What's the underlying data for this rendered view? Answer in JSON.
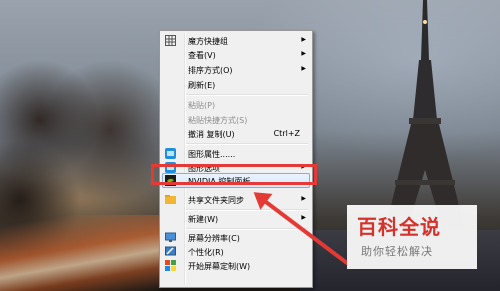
{
  "context_menu": {
    "items": [
      {
        "label": "魔方快捷组",
        "icon": "grid-icon",
        "submenu": true
      },
      {
        "label": "查看(V)",
        "submenu": true
      },
      {
        "label": "排序方式(O)",
        "submenu": true
      },
      {
        "label": "刷新(E)"
      },
      {
        "label": "粘贴(P)",
        "disabled": true
      },
      {
        "label": "粘贴快捷方式(S)",
        "disabled": true
      },
      {
        "label": "撤消 复制(U)",
        "shortcut": "Ctrl+Z"
      },
      {
        "label": "图形属性......",
        "icon": "intel-graphics-icon"
      },
      {
        "label": "图形选项",
        "icon": "intel-graphics-icon",
        "submenu": true
      },
      {
        "label": "NVIDIA 控制面板",
        "icon": "nvidia-icon",
        "highlighted": true
      },
      {
        "label": "共享文件夹同步",
        "icon": "sync-folder-icon",
        "submenu": true
      },
      {
        "label": "新建(W)",
        "submenu": true
      },
      {
        "label": "屏幕分辨率(C)",
        "icon": "display-icon"
      },
      {
        "label": "个性化(R)",
        "icon": "personalize-icon"
      },
      {
        "label": "开始屏幕定制(W)",
        "icon": "start-screen-icon"
      }
    ]
  },
  "watermark": {
    "title": "百科全说",
    "subtitle": "助你轻松解决"
  },
  "colors": {
    "annotation": "#e53935",
    "highlight_border": "#84acdd",
    "watermark_red": "#d4322b"
  }
}
